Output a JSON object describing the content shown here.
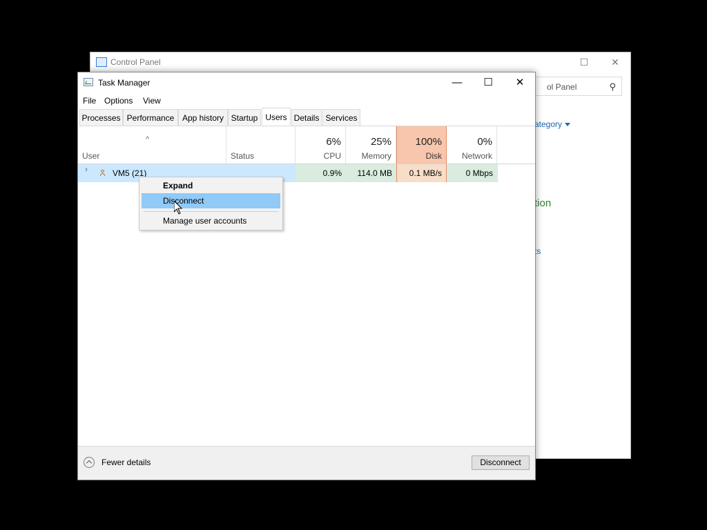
{
  "control_panel": {
    "title": "Control Panel",
    "search_placeholder": "ol Panel",
    "category_link": "ategory",
    "heading_fragment": "tion",
    "link_fragment": "ts"
  },
  "task_manager": {
    "title": "Task Manager",
    "menu": [
      "File",
      "Options",
      "View"
    ],
    "tabs": [
      "Processes",
      "Performance",
      "App history",
      "Startup",
      "Users",
      "Details",
      "Services"
    ],
    "active_tab": "Users",
    "columns": {
      "user": "User",
      "status": "Status",
      "cpu": {
        "pct": "6%",
        "label": "CPU"
      },
      "memory": {
        "pct": "25%",
        "label": "Memory"
      },
      "disk": {
        "pct": "100%",
        "label": "Disk"
      },
      "network": {
        "pct": "0%",
        "label": "Network"
      }
    },
    "rows": [
      {
        "user": "VM5 (21)",
        "status": "",
        "cpu": "0.9%",
        "memory": "114.0 MB",
        "disk": "0.1 MB/s",
        "network": "0 Mbps"
      }
    ],
    "context_menu": [
      "Expand",
      "Disconnect",
      "Manage user accounts"
    ],
    "footer": {
      "fewer_details": "Fewer details",
      "disconnect_button": "Disconnect"
    }
  },
  "colors": {
    "selection": "#cce8ff",
    "disk_header": "#f7c6ad",
    "menu_highlight": "#91c9f7"
  },
  "icons": [
    "control-panel-icon",
    "task-manager-icon",
    "search-icon",
    "user-icon",
    "chevron-right-icon",
    "fewer-details-icon",
    "mouse-cursor-icon"
  ]
}
